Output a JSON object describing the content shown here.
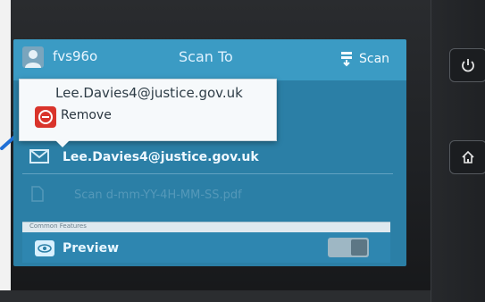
{
  "header": {
    "user_name": "fvs96o",
    "title": "Scan To",
    "scan_label": "Scan"
  },
  "popup": {
    "header_text": "Lee.Davies4@justice.gov.uk",
    "remove_label": "Remove"
  },
  "recipient": {
    "email": "Lee.Davies4@justice.gov.uk"
  },
  "filename": {
    "value": "Scan d-mm-YY-4H-MM-SS.pdf"
  },
  "features": {
    "label": "Common Features"
  },
  "preview": {
    "label": "Preview"
  },
  "colors": {
    "screen_blue": "#2b7fa6",
    "topbar_blue": "#3b9bc4",
    "remove_red": "#d9342b"
  },
  "icons": [
    "user-avatar-icon",
    "scan-icon",
    "remove-icon",
    "mail-icon",
    "file-icon",
    "eye-icon",
    "power-icon",
    "home-icon"
  ]
}
